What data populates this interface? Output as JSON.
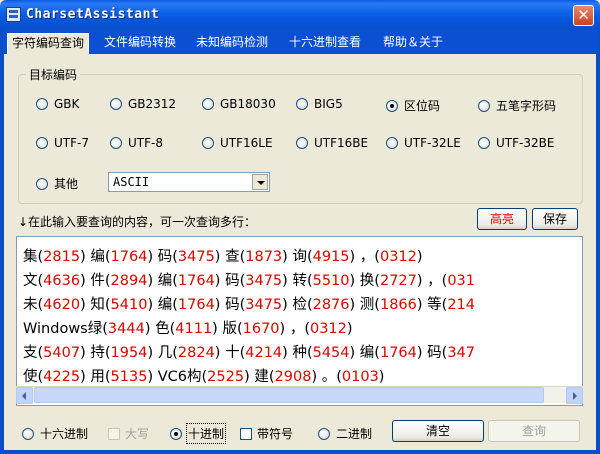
{
  "window": {
    "title": "CharsetAssistant",
    "close": "✕"
  },
  "tabs": [
    {
      "label": "字符编码查询",
      "active": true
    },
    {
      "label": "文件编码转换"
    },
    {
      "label": "未知编码检测"
    },
    {
      "label": "十六进制查看"
    },
    {
      "label": "帮助＆关于"
    }
  ],
  "encoding_group": {
    "legend": "目标编码",
    "options": [
      {
        "label": "GBK"
      },
      {
        "label": "GB2312"
      },
      {
        "label": "GB18030"
      },
      {
        "label": "BIG5"
      },
      {
        "label": "区位码",
        "checked": true
      },
      {
        "label": "五笔字形码"
      },
      {
        "label": "UTF-7"
      },
      {
        "label": "UTF-8"
      },
      {
        "label": "UTF16LE"
      },
      {
        "label": "UTF16BE"
      },
      {
        "label": "UTF-32LE"
      },
      {
        "label": "UTF-32BE"
      },
      {
        "label": "其他"
      }
    ],
    "other_select_value": "ASCII"
  },
  "prompt": "↓在此输入要查询的内容，可一次查询多行：",
  "buttons": {
    "highlight": "高亮",
    "save": "保存",
    "clear": "清空",
    "query": "查询"
  },
  "output_lines": [
    [
      [
        "集",
        "2815"
      ],
      [
        "编",
        "1764"
      ],
      [
        "码",
        "3475"
      ],
      [
        "查",
        "1873"
      ],
      [
        "询",
        "4915"
      ],
      [
        "，",
        "0312"
      ]
    ],
    [
      [
        "文",
        "4636"
      ],
      [
        "件",
        "2894"
      ],
      [
        "编",
        "1764"
      ],
      [
        "码",
        "3475"
      ],
      [
        "转",
        "5510"
      ],
      [
        "换",
        "2727"
      ],
      [
        "，",
        "031"
      ]
    ],
    [
      [
        "未",
        "4620"
      ],
      [
        "知",
        "5410"
      ],
      [
        "编",
        "1764"
      ],
      [
        "码",
        "3475"
      ],
      [
        "检",
        "2876"
      ],
      [
        "测",
        "1866"
      ],
      [
        "等",
        "214"
      ]
    ],
    [
      [
        "Windows绿",
        "3444"
      ],
      [
        "色",
        "4111"
      ],
      [
        "版",
        "1670"
      ],
      [
        "，",
        "0312"
      ]
    ],
    [
      [
        "支",
        "5407"
      ],
      [
        "持",
        "1954"
      ],
      [
        "几",
        "2824"
      ],
      [
        "十",
        "4214"
      ],
      [
        "种",
        "5454"
      ],
      [
        "编",
        "1764"
      ],
      [
        "码",
        "347"
      ]
    ],
    [
      [
        "使",
        "4225"
      ],
      [
        "用",
        "5135"
      ],
      [
        "VC6构",
        "2525"
      ],
      [
        "建",
        "2908"
      ],
      [
        "。",
        "0103"
      ]
    ]
  ],
  "bottom": {
    "hex": "十六进制",
    "uppercase": "大写",
    "decimal": "十进制",
    "signed": "带符号",
    "binary": "二进制"
  }
}
